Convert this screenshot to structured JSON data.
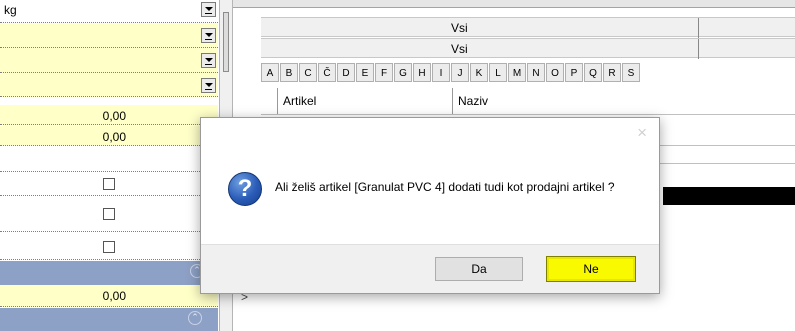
{
  "left_form": {
    "unit_value": "kg",
    "value_1": "0,00",
    "value_2": "0,00",
    "value_3": "0,00",
    "collapse_icon": "chevron-up-circle-icon"
  },
  "grid": {
    "group_row_1": "Vsi",
    "group_row_2": "Vsi",
    "letters": [
      "A",
      "B",
      "C",
      "Č",
      "D",
      "E",
      "F",
      "G",
      "H",
      "I",
      "J",
      "K",
      "L",
      "M",
      "N",
      "O",
      "P",
      "Q",
      "R",
      "S"
    ],
    "col_artikel": "Artikel",
    "col_naziv": "Naziv",
    "side_marker": ">"
  },
  "dialog": {
    "close_glyph": "×",
    "icon": "question-icon",
    "icon_glyph": "?",
    "message": "Ali želiš artikel [Granulat PVC 4] dodati tudi kot prodajni artikel ?",
    "btn_yes": "Da",
    "btn_no": "Ne"
  },
  "colors": {
    "highlight": "#f9f900",
    "form_yellow": "#ffffc8",
    "section_blue": "#8da0c5"
  }
}
